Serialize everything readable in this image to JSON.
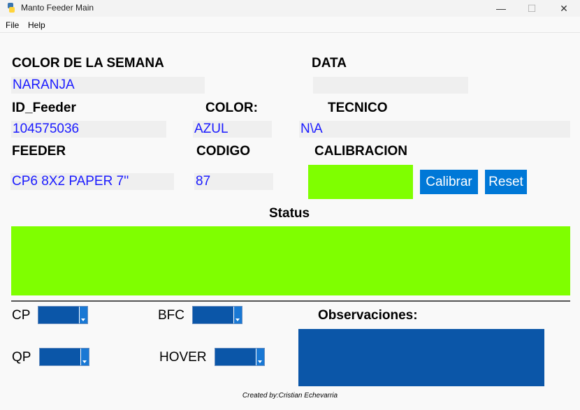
{
  "window": {
    "title": "Manto Feeder Main",
    "minimize_icon": "—",
    "maximize_icon": "☐",
    "close_icon": "✕"
  },
  "menu": {
    "file": "File",
    "help": "Help"
  },
  "fields": {
    "color_semana_label": "COLOR DE LA SEMANA",
    "color_semana_value": "NARANJA",
    "data_label": "DATA",
    "data_value": "",
    "id_feeder_label": "ID_Feeder",
    "id_feeder_value": "104575036",
    "color_label": "COLOR:",
    "color_value": "AZUL",
    "tecnico_label": "TECNICO",
    "tecnico_value": "N\\A",
    "feeder_label": "FEEDER",
    "feeder_value": "CP6 8X2 PAPER 7''",
    "codigo_label": "CODIGO",
    "codigo_value": "87",
    "calibracion_label": "CALIBRACION"
  },
  "buttons": {
    "calibrar": "Calibrar",
    "reset": "Reset"
  },
  "status": {
    "label": "Status"
  },
  "selectors": {
    "cp": "CP",
    "bfc": "BFC",
    "qp": "QP",
    "hover": "HOVER"
  },
  "observaciones": {
    "label": "Observaciones:"
  },
  "footer": {
    "credit": "Created by:Cristian Echevarria"
  },
  "colors": {
    "indicator_green": "#7fff00",
    "button_blue": "#0078d7",
    "value_text": "#1a1aff",
    "combo_blue": "#0b56a8"
  }
}
